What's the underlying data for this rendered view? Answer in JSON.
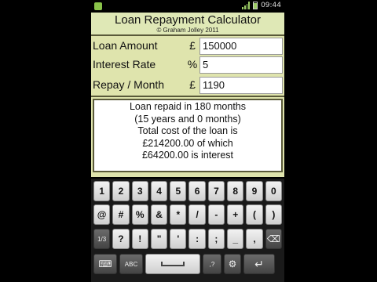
{
  "status_bar": {
    "time": "09:44"
  },
  "app": {
    "title": "Loan Repayment Calculator",
    "subtitle": "© Graham Jolley 2011"
  },
  "fields": [
    {
      "label": "Loan Amount",
      "unit": "£",
      "value": "150000"
    },
    {
      "label": "Interest Rate",
      "unit": "%",
      "value": "5"
    },
    {
      "label": "Repay / Month",
      "unit": "£",
      "value": "1190"
    }
  ],
  "result": {
    "line1": "Loan repaid in 180 months",
    "line2": "(15 years and 0 months)",
    "line3": "Total cost of the loan is",
    "line4": "£214200.00 of which",
    "line5": "£64200.00 is interest"
  },
  "keyboard": {
    "row1": [
      "1",
      "2",
      "3",
      "4",
      "5",
      "6",
      "7",
      "8",
      "9",
      "0"
    ],
    "row2": [
      "@",
      "#",
      "%",
      "&",
      "*",
      "/",
      "-",
      "+",
      "(",
      ")"
    ],
    "row3": [
      "1/3",
      "?",
      "!",
      "\"",
      "'",
      ":",
      ";",
      "_",
      ",",
      "⌫"
    ],
    "row4": {
      "left": "⌨",
      "abc": "ABC",
      "sym": ",?",
      "settings": "⚙",
      "enter": "↵"
    }
  }
}
